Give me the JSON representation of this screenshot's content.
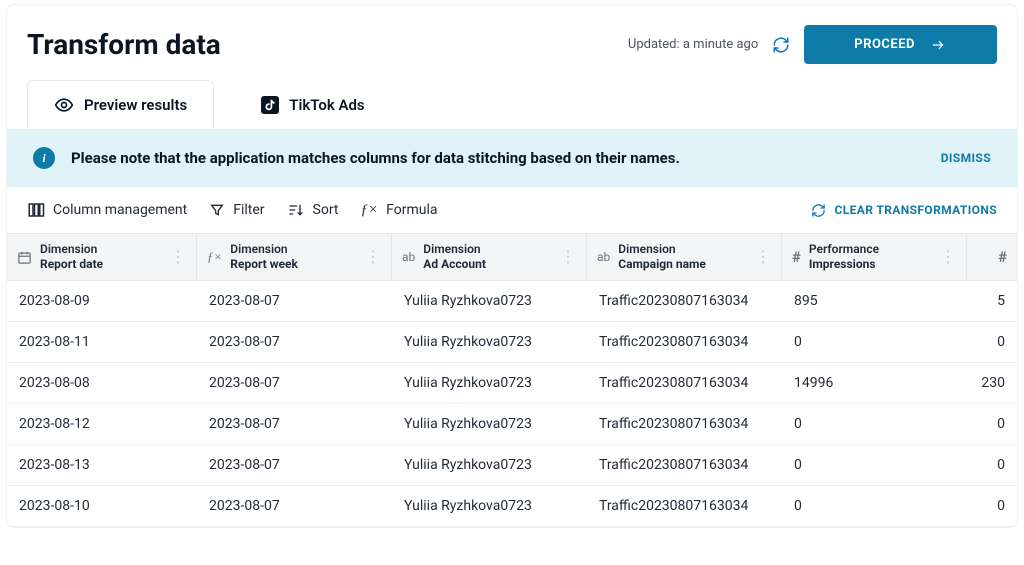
{
  "header": {
    "title": "Transform data",
    "updated": "Updated: a minute ago",
    "proceed": "PROCEED"
  },
  "tabs": [
    {
      "label": "Preview results"
    },
    {
      "label": "TikTok Ads"
    }
  ],
  "banner": {
    "text": "Please note that the application matches columns for data stitching based on their names.",
    "dismiss": "DISMISS"
  },
  "toolbar": {
    "columns": "Column management",
    "filter": "Filter",
    "sort": "Sort",
    "formula": "Formula",
    "clear": "CLEAR TRANSFORMATIONS"
  },
  "columns": [
    {
      "group": "Dimension",
      "name": "Report date",
      "icon": "calendar"
    },
    {
      "group": "Dimension",
      "name": "Report week",
      "icon": "fx"
    },
    {
      "group": "Dimension",
      "name": "Ad Account",
      "icon": "ab"
    },
    {
      "group": "Dimension",
      "name": "Campaign name",
      "icon": "ab"
    },
    {
      "group": "Performance",
      "name": "Impressions",
      "icon": "hash"
    },
    {
      "group": "",
      "name": "",
      "icon": "hash"
    }
  ],
  "rows": [
    {
      "c0": "2023-08-09",
      "c1": "2023-08-07",
      "c2": "Yuliia Ryzhkova0723",
      "c3": "Traffic20230807163034",
      "c4": "895",
      "c5": "5"
    },
    {
      "c0": "2023-08-11",
      "c1": "2023-08-07",
      "c2": "Yuliia Ryzhkova0723",
      "c3": "Traffic20230807163034",
      "c4": "0",
      "c5": "0"
    },
    {
      "c0": "2023-08-08",
      "c1": "2023-08-07",
      "c2": "Yuliia Ryzhkova0723",
      "c3": "Traffic20230807163034",
      "c4": "14996",
      "c5": "230"
    },
    {
      "c0": "2023-08-12",
      "c1": "2023-08-07",
      "c2": "Yuliia Ryzhkova0723",
      "c3": "Traffic20230807163034",
      "c4": "0",
      "c5": "0"
    },
    {
      "c0": "2023-08-13",
      "c1": "2023-08-07",
      "c2": "Yuliia Ryzhkova0723",
      "c3": "Traffic20230807163034",
      "c4": "0",
      "c5": "0"
    },
    {
      "c0": "2023-08-10",
      "c1": "2023-08-07",
      "c2": "Yuliia Ryzhkova0723",
      "c3": "Traffic20230807163034",
      "c4": "0",
      "c5": "0"
    }
  ]
}
